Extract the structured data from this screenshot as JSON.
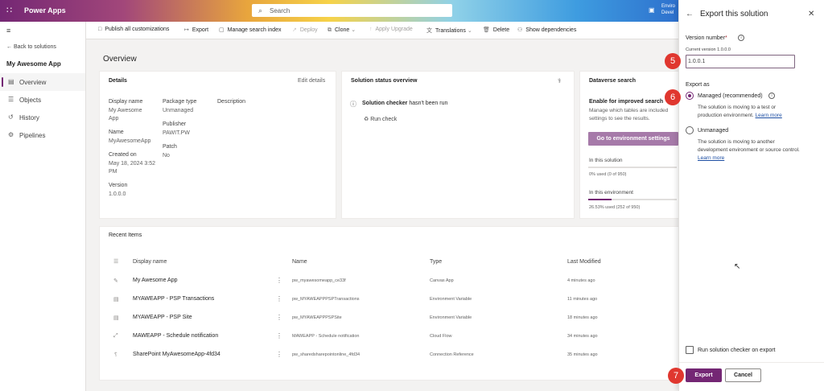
{
  "header": {
    "app_name": "Power Apps",
    "search_placeholder": "Search",
    "env_line1": "Enviro",
    "env_line2": "Devel"
  },
  "nav": {
    "back": "Back to solutions",
    "app": "My Awesome App",
    "items": [
      {
        "label": "Overview",
        "icon": "overview-icon",
        "active": true
      },
      {
        "label": "Objects",
        "icon": "objects-icon"
      },
      {
        "label": "History",
        "icon": "history-icon"
      },
      {
        "label": "Pipelines",
        "icon": "pipelines-icon"
      }
    ]
  },
  "commands": {
    "publish": "Publish all customizations",
    "export": "Export",
    "manage_search": "Manage search index",
    "deploy": "Deploy",
    "clone": "Clone",
    "apply_upgrade": "Apply Upgrade",
    "translations": "Translations",
    "delete": "Delete",
    "show_deps": "Show dependencies"
  },
  "page": {
    "title": "Overview"
  },
  "details": {
    "title": "Details",
    "edit": "Edit details",
    "display_name_label": "Display name",
    "display_name_value1": "My Awesome",
    "display_name_value2": "App",
    "name_label": "Name",
    "name_value": "MyAwesomeApp",
    "created_label": "Created on",
    "created_value1": "May 18, 2024 3:52",
    "created_value2": "PM",
    "version_label": "Version",
    "version_value": "1.0.0.0",
    "package_label": "Package type",
    "package_value": "Unmanaged",
    "publisher_label": "Publisher",
    "publisher_value": "PAWIT.PW",
    "patch_label": "Patch",
    "patch_value": "No",
    "description_label": "Description"
  },
  "status": {
    "title": "Solution status overview",
    "checker_bold": "Solution checker",
    "checker_rest": " hasn't been run",
    "run_check": "Run check"
  },
  "dataverse": {
    "title": "Dataverse search",
    "enable": "Enable for improved search",
    "desc1": "Manage which tables are included",
    "desc2": "settings to see the results.",
    "button": "Go to environment settings",
    "in_solution": "In this solution",
    "in_solution_used": "0% used (0 of 950)",
    "in_solution_fraction": 0,
    "in_env": "In this environment",
    "in_env_used": "26.53% used (252 of 950)",
    "in_env_fraction": 0.2653
  },
  "recent": {
    "title": "Recent Items",
    "columns": [
      "Display name",
      "Name",
      "Type",
      "Last Modified"
    ],
    "rows": [
      {
        "icon": "pencil-icon",
        "display": "My Awesome App",
        "name": "pw_myawesomeapp_ce33f",
        "type": "Canvas App",
        "modified": "4 minutes ago"
      },
      {
        "icon": "table-icon",
        "display": "MYAWEAPP - PSP Transactions",
        "name": "pw_MYAWEAPPPSPTransactions",
        "type": "Environment Variable",
        "modified": "11 minutes ago"
      },
      {
        "icon": "table-icon",
        "display": "MYAWEAPP - PSP Site",
        "name": "pw_MYAWEAPPPSPSite",
        "type": "Environment Variable",
        "modified": "18 minutes ago"
      },
      {
        "icon": "flow-icon",
        "display": "MAWEAPP - Schedule notification",
        "name": "MAWEAPP - Schedule notification",
        "type": "Cloud Flow",
        "modified": "34 minutes ago"
      },
      {
        "icon": "connection-icon",
        "display": "SharePoint MyAwesomeApp-4fd34",
        "name": "pw_sharedsharepointonline_4fd34",
        "type": "Connection Reference",
        "modified": "35 minutes ago"
      }
    ]
  },
  "panel": {
    "title": "Export this solution",
    "version_label": "Version number",
    "required_mark": "*",
    "current_version": "Current version 1.0.0.0",
    "version_value": "1.0.0.1",
    "export_as": "Export as",
    "managed_label": "Managed (recommended)",
    "managed_desc1": "The solution is moving to a test or",
    "managed_desc2": "production environment.",
    "learn_more": "Learn more",
    "unmanaged_label": "Unmanaged",
    "unmanaged_desc1": "The solution is moving to another",
    "unmanaged_desc2": "development environment or source control.",
    "run_checker": "Run solution checker on export",
    "export_btn": "Export",
    "cancel_btn": "Cancel"
  },
  "steps": {
    "s5": "5",
    "s6": "6",
    "s7": "7"
  },
  "colors": {
    "accent": "#742774",
    "step": "#e0372f",
    "link": "#1d4ea3"
  }
}
